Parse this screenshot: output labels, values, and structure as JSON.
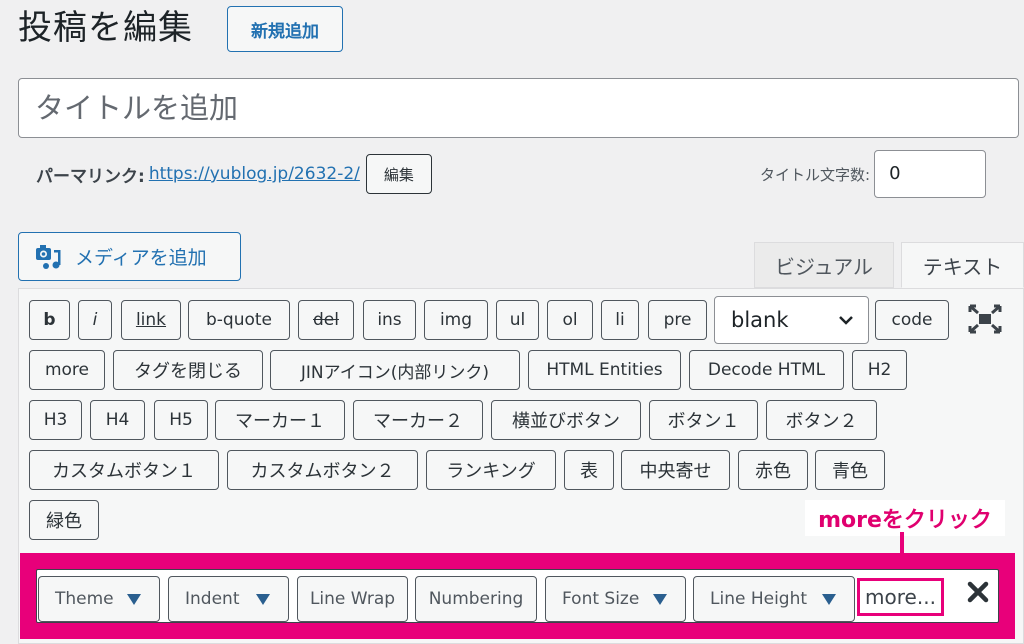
{
  "header": {
    "title": "投稿を編集",
    "add_new_label": "新規追加"
  },
  "title_field": {
    "placeholder": "タイトルを追加",
    "value": ""
  },
  "permalink": {
    "label": "パーマリンク:",
    "url": "https://yublog.jp/2632-2/",
    "edit_label": "編集"
  },
  "title_count": {
    "label": "タイトル文字数:",
    "value": "0"
  },
  "media": {
    "add_media_label": "メディアを追加"
  },
  "editor_tabs": [
    {
      "label": "ビジュアル",
      "active": false
    },
    {
      "label": "テキスト",
      "active": true
    }
  ],
  "quicktags": {
    "row1": [
      "b",
      "i",
      "link",
      "b-quote",
      "del",
      "ins",
      "img",
      "ul",
      "ol",
      "li",
      "pre"
    ],
    "select_value": "blank",
    "code_label": "code",
    "row2": [
      "more",
      "タグを閉じる",
      "JINアイコン(内部リンク)",
      "HTML Entities",
      "Decode HTML",
      "H2"
    ],
    "row3": [
      "H3",
      "H4",
      "H5",
      "マーカー１",
      "マーカー２",
      "横並びボタン",
      "ボタン１",
      "ボタン２"
    ],
    "row4": [
      "カスタムボタン１",
      "カスタムボタン２",
      "ランキング",
      "表",
      "中央寄せ",
      "赤色",
      "青色"
    ],
    "row5": [
      "緑色"
    ]
  },
  "codemirror_panel": {
    "buttons": [
      {
        "label": "Theme",
        "dropdown": true
      },
      {
        "label": "Indent",
        "dropdown": true
      },
      {
        "label": "Line Wrap",
        "dropdown": false
      },
      {
        "label": "Numbering",
        "dropdown": false
      },
      {
        "label": "Font Size",
        "dropdown": true
      },
      {
        "label": "Line Height",
        "dropdown": true
      }
    ],
    "more_label": "more..."
  },
  "annotation": {
    "text": "moreをクリック",
    "color": "#e8007a"
  },
  "colors": {
    "accent": "#2271b1",
    "highlight": "#e8007a",
    "background": "#f0f0f1"
  }
}
